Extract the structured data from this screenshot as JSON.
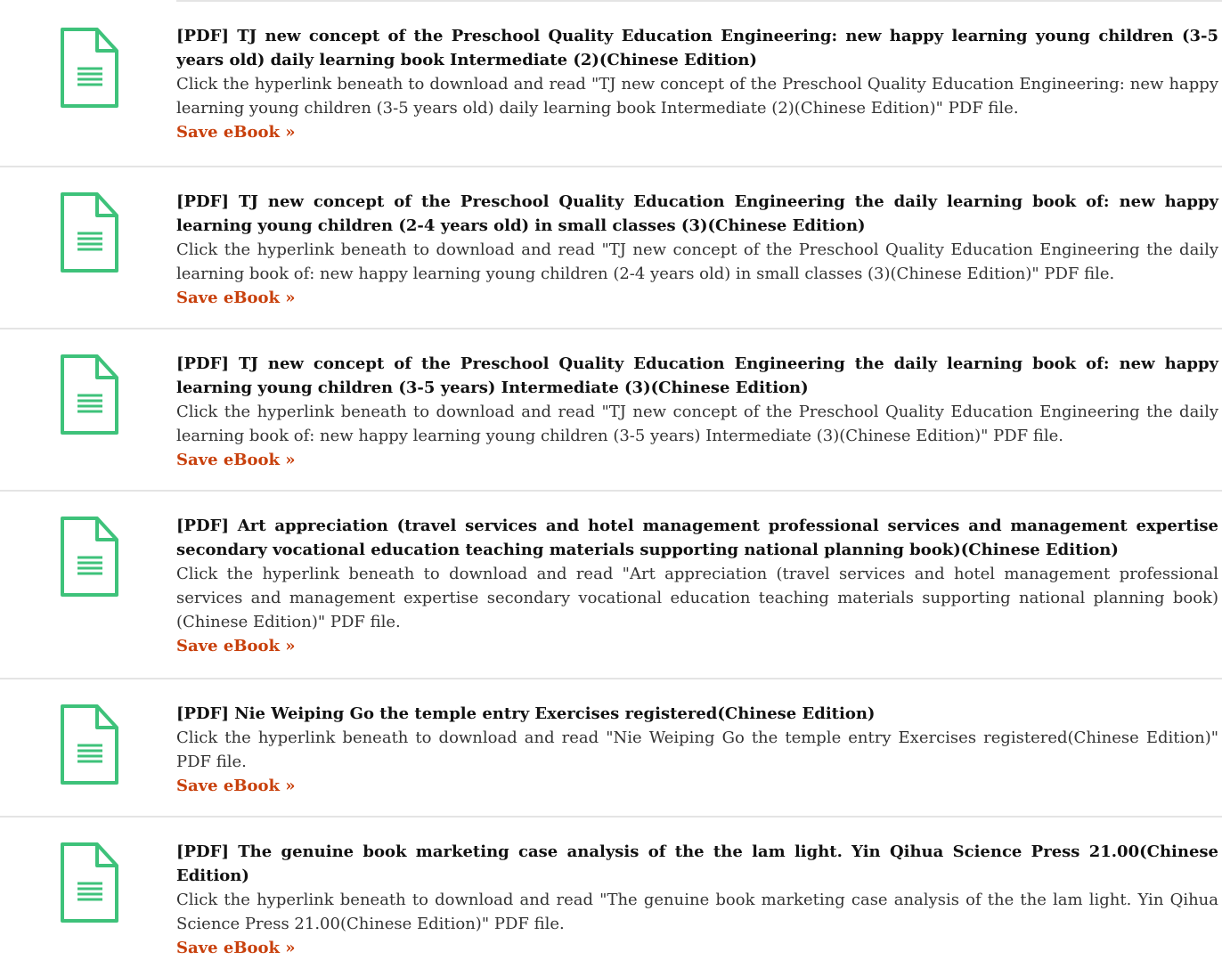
{
  "colors": {
    "icon": "#3ec27a",
    "link": "#c8400c",
    "divider": "#e4e4e4"
  },
  "items": [
    {
      "icon": "document-icon",
      "title": "[PDF] TJ new concept of the Preschool Quality Education Engineering: new happy learning young children (3-5 years old) daily learning book Intermediate (2)(Chinese Edition)",
      "description": "Click the hyperlink beneath to download and read \"TJ new concept of the Preschool Quality Education Engineering: new happy learning young children (3-5 years old) daily learning book Intermediate (2)(Chinese Edition)\" PDF file.",
      "link": "Save eBook »"
    },
    {
      "icon": "document-icon",
      "title": "[PDF] TJ new concept of the Preschool Quality Education Engineering the daily learning book of: new happy learning young children (2-4 years old) in small classes (3)(Chinese Edition)",
      "description": "Click the hyperlink beneath to download and read \"TJ new concept of the Preschool Quality Education Engineering the daily learning book of: new happy learning young children (2-4 years old) in small classes (3)(Chinese Edition)\" PDF file.",
      "link": "Save eBook »"
    },
    {
      "icon": "document-icon",
      "title": "[PDF] TJ new concept of the Preschool Quality Education Engineering the daily learning book of: new happy learning young children (3-5 years) Intermediate (3)(Chinese Edition)",
      "description": "Click the hyperlink beneath to download and read \"TJ new concept of the Preschool Quality Education Engineering the daily learning book of: new happy learning young children (3-5 years) Intermediate (3)(Chinese Edition)\" PDF file.",
      "link": "Save eBook »"
    },
    {
      "icon": "document-icon",
      "title": "[PDF] Art appreciation (travel services and hotel management professional services and management expertise secondary vocational education teaching materials supporting national planning book)(Chinese Edition)",
      "description": "Click the hyperlink beneath to download and read \"Art appreciation (travel services and hotel management professional services and management expertise secondary vocational education teaching materials supporting national planning book)(Chinese Edition)\" PDF file.",
      "link": "Save eBook »"
    },
    {
      "icon": "document-icon",
      "title": "[PDF] Nie Weiping Go the temple entry Exercises registered(Chinese Edition)",
      "description": "Click the hyperlink beneath to download and read \"Nie Weiping Go the temple entry Exercises registered(Chinese Edition)\" PDF file.",
      "link": "Save eBook »"
    },
    {
      "icon": "document-icon",
      "title": "[PDF] The genuine book marketing case analysis of the the lam light. Yin Qihua Science Press 21.00(Chinese Edition)",
      "description": "Click the hyperlink beneath to download and read \"The genuine book marketing case analysis of the the lam light. Yin Qihua Science Press 21.00(Chinese Edition)\" PDF file.",
      "link": "Save eBook »"
    }
  ]
}
